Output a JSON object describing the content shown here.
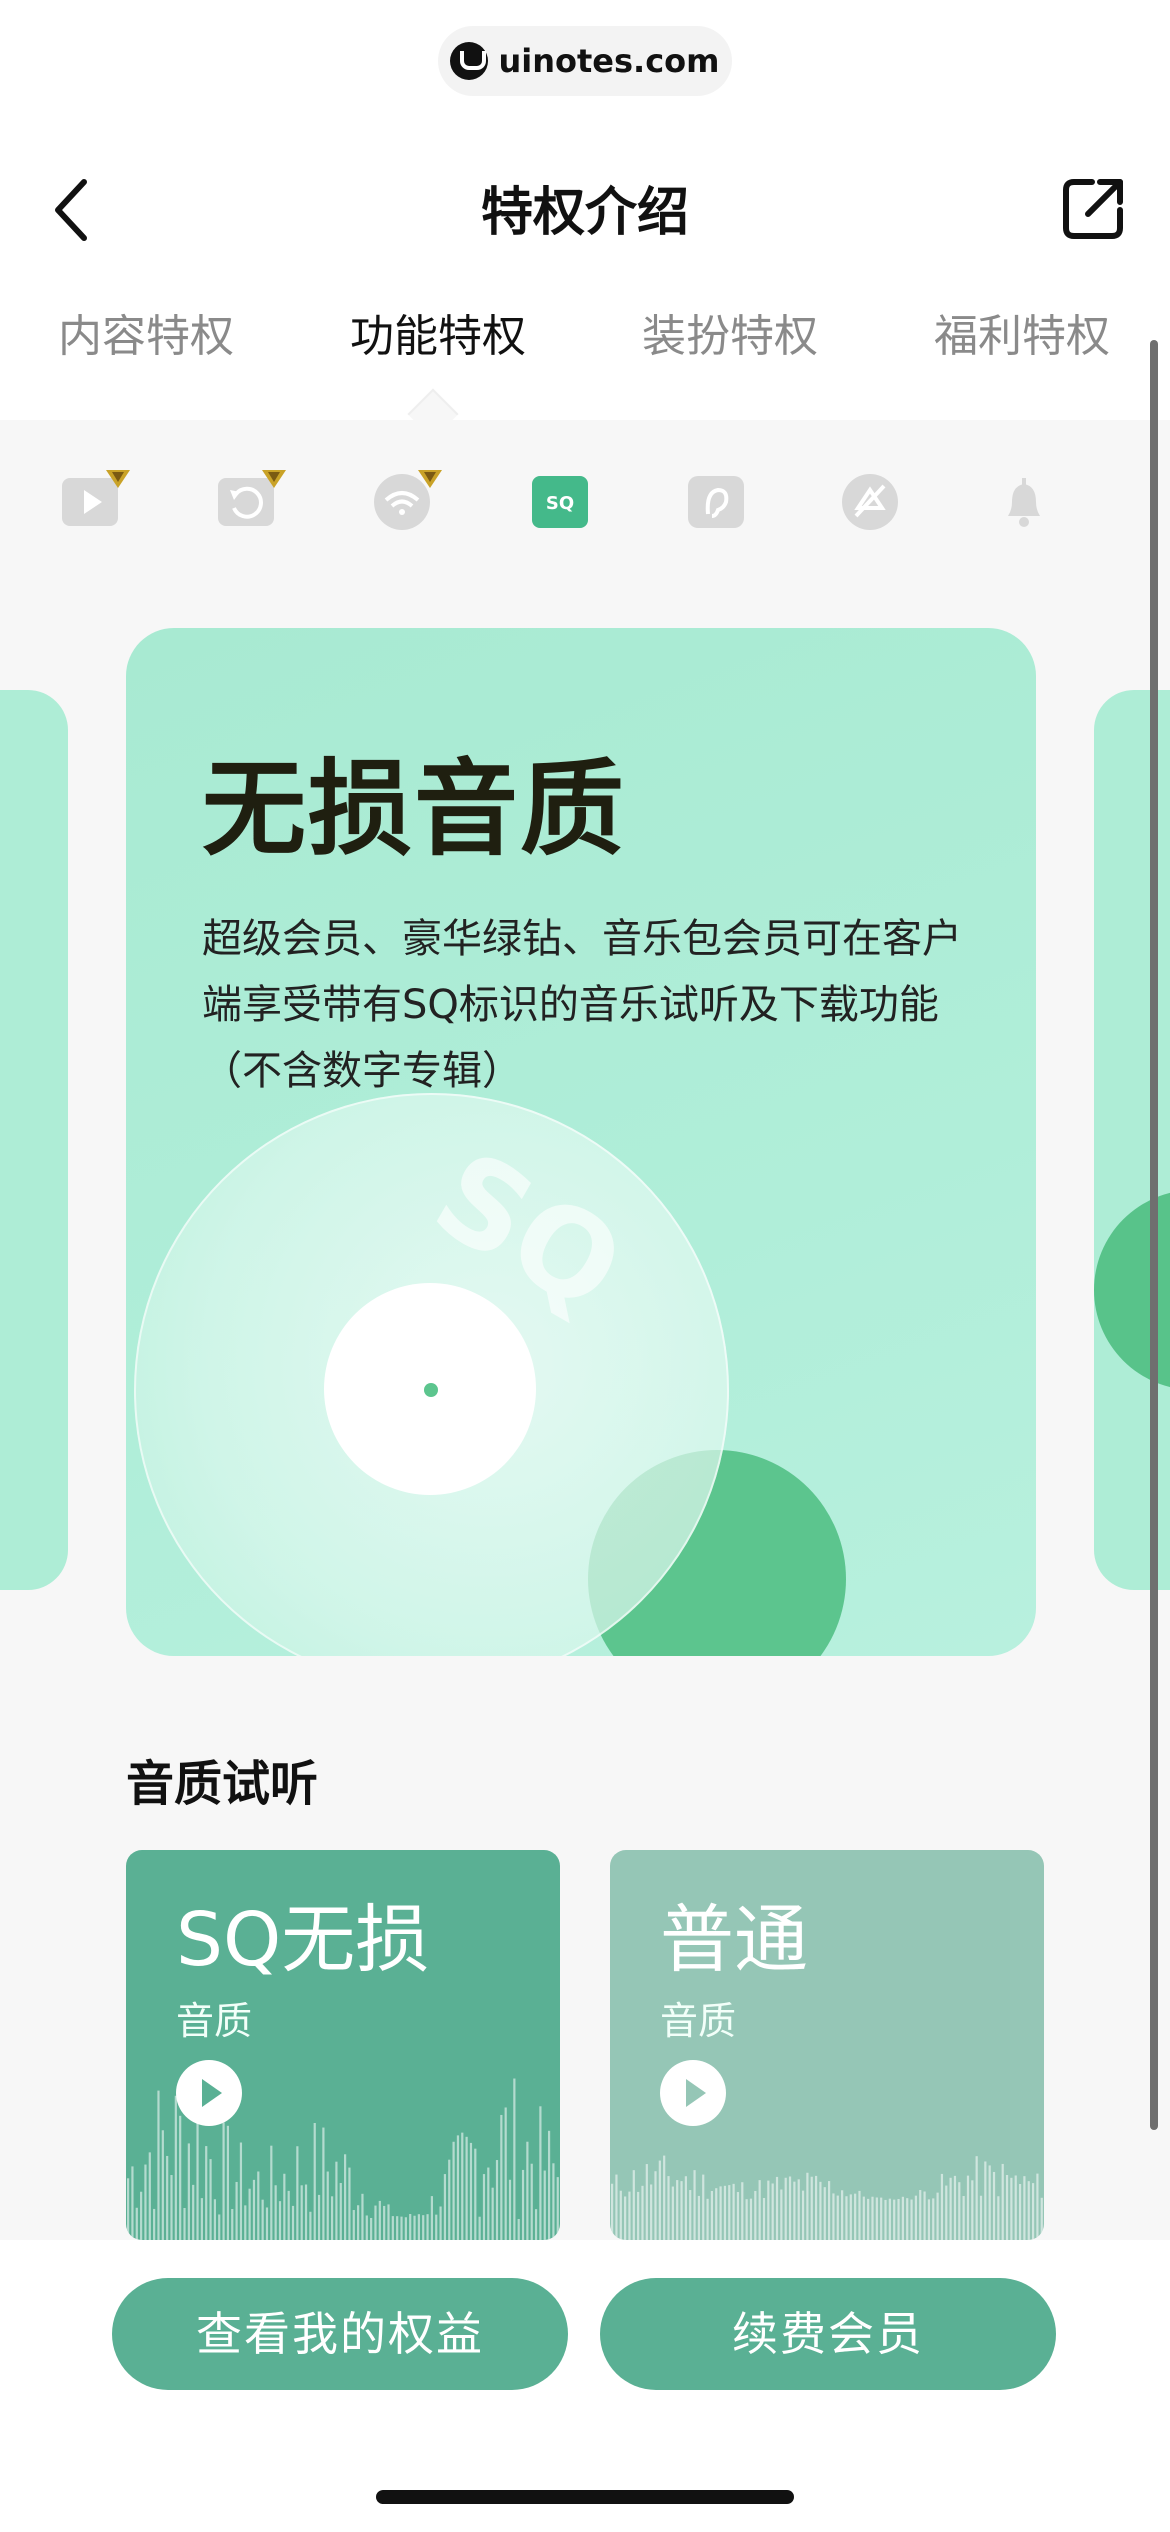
{
  "url": {
    "text": "uinotes.com",
    "logo_icon": "uinotes-logo-icon"
  },
  "header": {
    "title": "特权介绍",
    "back_icon": "chevron-left-icon",
    "share_icon": "share-external-icon"
  },
  "tabs": [
    {
      "label": "内容特权",
      "active": false
    },
    {
      "label": "功能特权",
      "active": true
    },
    {
      "label": "装扮特权",
      "active": false
    },
    {
      "label": "福利特权",
      "active": false
    }
  ],
  "feature_icons": [
    {
      "name": "video-icon",
      "crown": true
    },
    {
      "name": "rewind-icon",
      "crown": true
    },
    {
      "name": "wifi-icon",
      "crown": true
    },
    {
      "name": "sq-icon",
      "crown": false,
      "selected": true
    },
    {
      "name": "ear-icon",
      "crown": false
    },
    {
      "name": "no-ad-icon",
      "crown": false
    },
    {
      "name": "bell-icon",
      "crown": false
    }
  ],
  "feature_card": {
    "title": "无损音质",
    "description": "超级会员、豪华绿钻、音乐包会员可在客户端享受带有SQ标识的音乐试听及下载功能（不含数字专辑）",
    "disc_label": "SQ"
  },
  "quality_section": {
    "title": "音质试听",
    "items": [
      {
        "title": "SQ无损",
        "subtitle": "音质"
      },
      {
        "title": "普通",
        "subtitle": "音质"
      }
    ]
  },
  "buttons": {
    "rights": "查看我的权益",
    "renew": "续费会员"
  },
  "colors": {
    "accent": "#5ab094",
    "card": "#b0eed9",
    "disc_green": "#5cc58e",
    "sq_icon": "#44b98a"
  }
}
